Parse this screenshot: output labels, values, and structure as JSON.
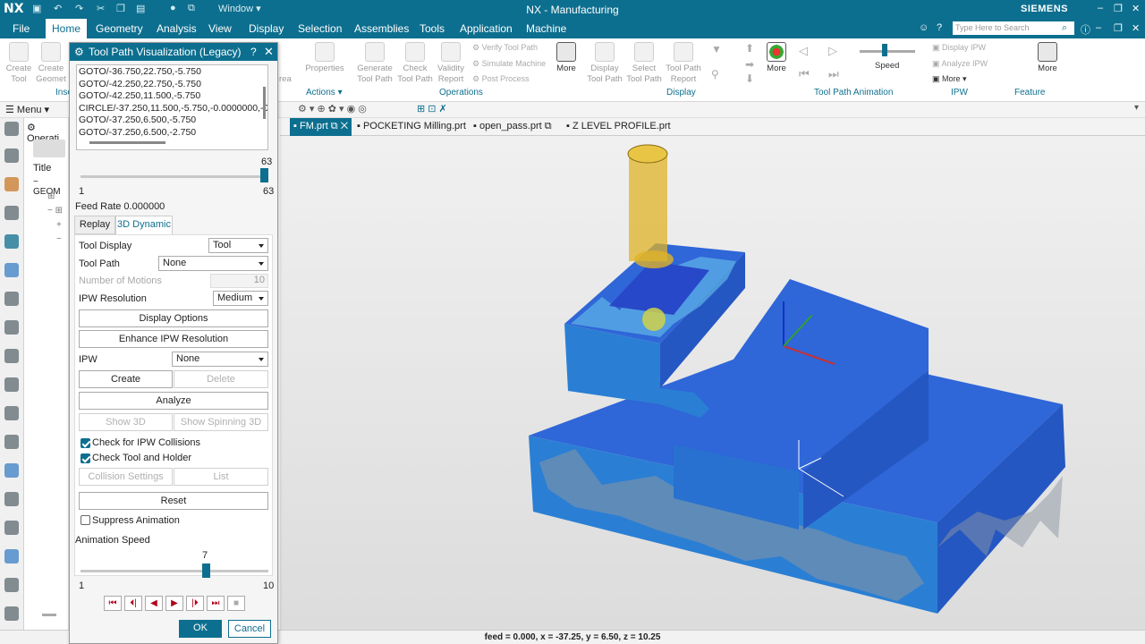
{
  "titlebar": {
    "logo": "NX",
    "window_label": "Window",
    "title": "NX - Manufacturing",
    "brand": "SIEMENS"
  },
  "menubar": {
    "tabs": [
      "File",
      "Home",
      "Geometry",
      "Analysis",
      "View",
      "Display",
      "Selection",
      "Assemblies",
      "Tools",
      "Application",
      "Machine"
    ],
    "search_placeholder": "Type Here to Search"
  },
  "ribbon": {
    "create_tool": "Create Tool",
    "create_geom": "Create Geomet",
    "insert": "Inse",
    "properties": "Properties",
    "actions": "Actions",
    "generate": "Generate Tool Path",
    "check": "Check Tool Path",
    "validity": "Validity Report",
    "verify": "Verify Tool Path",
    "simulate": "Simulate Machine",
    "post": "Post Process",
    "more": "More",
    "operations": "Operations",
    "display_tp": "Display Tool Path",
    "select_tp": "Select Tool Path",
    "tp_report": "Tool Path Report",
    "display": "Display",
    "speed": "Speed",
    "tpa": "Tool Path Animation",
    "display_ipw": "Display IPW",
    "analyze_ipw": "Analyze IPW",
    "ipw": "IPW",
    "feature": "Feature",
    "area_frag": "rea"
  },
  "toolbar2": {
    "menu": "Menu"
  },
  "navigator": {
    "operation": "Operati",
    "title_col": "Title",
    "geom": "GEOM"
  },
  "viewport_tabs": [
    "FM.prt",
    "POCKETING Milling.prt",
    "open_pass.prt",
    "Z LEVEL PROFILE.prt"
  ],
  "status": "feed = 0.000, x = -37.25, y = 6.50, z = 10.25",
  "dialog": {
    "title": "Tool Path Visualization (Legacy)",
    "code_lines": [
      "GOTO/-36.750,22.750,-5.750",
      "GOTO/-42.250,22.750,-5.750",
      "GOTO/-42.250,11.500,-5.750",
      "CIRCLE/-37.250,11.500,-5.750,-0.0000000,-0.000",
      "GOTO/-37.250,6.500,-5.750",
      "GOTO/-37.250,6.500,-2.750"
    ],
    "slider_value": "63",
    "slider_min": "1",
    "slider_max": "63",
    "slider_fraction": 1.0,
    "feed_rate": "Feed Rate 0.000000",
    "tabs": [
      "Replay",
      "3D Dynamic"
    ],
    "tool_display_label": "Tool Display",
    "tool_display_value": "Tool",
    "tool_path_label": "Tool Path",
    "tool_path_value": "None",
    "motions_label": "Number of Motions",
    "motions_value": "10",
    "ipw_res_label": "IPW Resolution",
    "ipw_res_value": "Medium",
    "display_options": "Display Options",
    "enhance": "Enhance IPW Resolution",
    "ipw_label": "IPW",
    "ipw_value": "None",
    "create": "Create",
    "delete": "Delete",
    "analyze": "Analyze",
    "show3d": "Show 3D",
    "spin3d": "Show Spinning 3D",
    "check_collisions": "Check for IPW Collisions",
    "check_holder": "Check Tool and Holder",
    "collision_settings": "Collision Settings",
    "list": "List",
    "reset": "Reset",
    "suppress": "Suppress Animation",
    "anim_speed": "Animation Speed",
    "anim_value": "7",
    "anim_min": "1",
    "anim_max": "10",
    "anim_fraction": 0.667,
    "ok": "OK",
    "cancel": "Cancel"
  },
  "colors": {
    "accent": "#0d6f8f",
    "part": "#2a63e0",
    "tool": "#e0b328"
  }
}
